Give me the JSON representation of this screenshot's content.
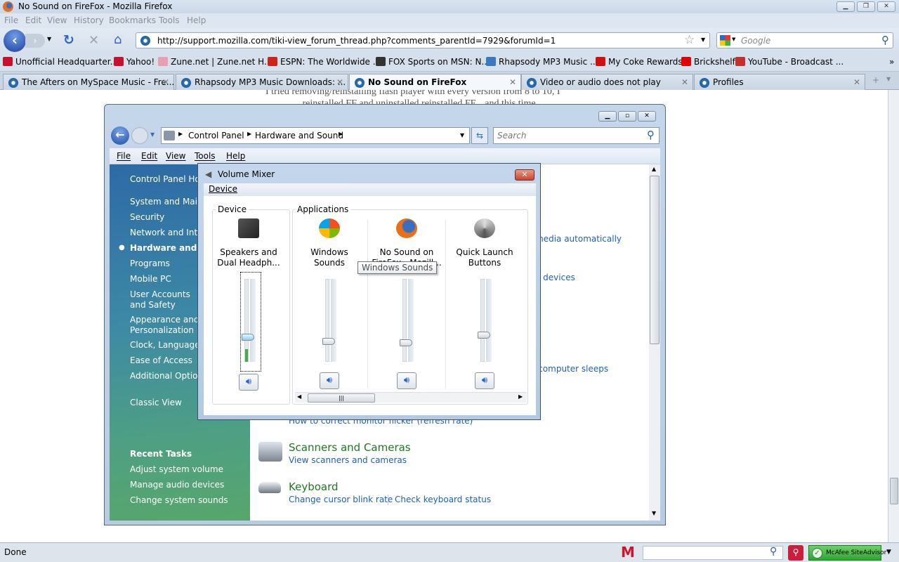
{
  "browser": {
    "title": "No Sound on FireFox - Mozilla Firefox",
    "menu": [
      "File",
      "Edit",
      "View",
      "History",
      "Bookmarks",
      "Tools",
      "Help"
    ],
    "url": "http://support.mozilla.com/tiki-view_forum_thread.php?comments_parentId=7929&forumId=1",
    "search_placeholder": "Google",
    "bookmarks": [
      {
        "label": "Unofficial Headquarter...",
        "icon": "yahoo-icon",
        "color": "#c8102e"
      },
      {
        "label": "Yahoo!",
        "icon": "yahoo-icon",
        "color": "#c8102e"
      },
      {
        "label": "Zune.net | Zune.net H...",
        "icon": "zune-icon",
        "color": "#e8a0b0"
      },
      {
        "label": "ESPN: The Worldwide ...",
        "icon": "espn-icon",
        "color": "#d0221a"
      },
      {
        "label": "FOX Sports on MSN: N...",
        "icon": "fox-icon",
        "color": "#333333"
      },
      {
        "label": "Rhapsody MP3 Music ...",
        "icon": "rhapsody-icon",
        "color": "#3a78c2"
      },
      {
        "label": "My Coke Rewards",
        "icon": "coke-icon",
        "color": "#d01010"
      },
      {
        "label": "Brickshelf",
        "icon": "brick-icon",
        "color": "#e00000"
      },
      {
        "label": "YouTube - Broadcast ...",
        "icon": "youtube-icon",
        "color": "#c4302b"
      }
    ],
    "tabs": [
      {
        "label": "The Afters on MySpace Music - Fre...",
        "active": false
      },
      {
        "label": "Rhapsody MP3 Music Downloads: ...",
        "active": false
      },
      {
        "label": "No Sound on FireFox",
        "active": true
      },
      {
        "label": "Video or audio does not play",
        "active": false
      },
      {
        "label": "Profiles",
        "active": false
      }
    ],
    "page_text": [
      "I tried removing/reinstalling flash player with every version from 8 to 10, I",
      "...reinstalled FF and uninstalled reinstalled FF... and this time..."
    ],
    "status": "Done",
    "mcafee": "McAfee SiteAdvisor"
  },
  "explorer": {
    "breadcrumb": [
      "Control Panel",
      "Hardware and Sound"
    ],
    "search_placeholder": "Search",
    "menu": [
      "File",
      "Edit",
      "View",
      "Tools",
      "Help"
    ],
    "sidebar": [
      {
        "label": "Control Panel Home"
      },
      {
        "label": "System and Maintenance"
      },
      {
        "label": "Security"
      },
      {
        "label": "Network and Internet"
      },
      {
        "label": "Hardware and Sound",
        "active": true
      },
      {
        "label": "Programs"
      },
      {
        "label": "Mobile PC"
      },
      {
        "label": "User Accounts and Safety"
      },
      {
        "label": "Appearance and Personalization"
      },
      {
        "label": "Clock, Language, and Region"
      },
      {
        "label": "Ease of Access"
      },
      {
        "label": "Additional Options"
      },
      {
        "label": "Classic View"
      }
    ],
    "recent_tasks_title": "Recent Tasks",
    "recent_tasks": [
      "Adjust system volume",
      "Manage audio devices",
      "Change system sounds"
    ],
    "partial_links": [
      "media automatically",
      "o devices",
      "e computer sleeps",
      "How to correct monitor flicker (refresh rate)"
    ],
    "categories": [
      {
        "title": "Scanners and Cameras",
        "links": [
          "View scanners and cameras"
        ]
      },
      {
        "title": "Keyboard",
        "links": [
          "Change cursor blink rate",
          "Check keyboard status"
        ]
      }
    ]
  },
  "mixer": {
    "title": "Volume Mixer",
    "menu": "Device",
    "device_group": "Device",
    "apps_group": "Applications",
    "tooltip": "Windows Sounds",
    "channels": [
      {
        "name": "Speakers and Dual Headph...",
        "line1": "Speakers and",
        "line2": "Dual Headph...",
        "icon": "laptop-speakers-icon",
        "volume": 0.3,
        "meter": 0.15
      },
      {
        "name": "Windows Sounds",
        "line1": "Windows",
        "line2": "Sounds",
        "icon": "windows-logo-icon",
        "volume": 0.25
      },
      {
        "name": "No Sound on FireFox - Mozill...",
        "line1": "No Sound on",
        "line2": "FireFox - Mozill...",
        "icon": "firefox-icon",
        "volume": 0.23
      },
      {
        "name": "Quick Launch Buttons",
        "line1": "Quick Launch",
        "line2": "Buttons",
        "icon": "quick-launch-icon",
        "volume": 0.32
      }
    ]
  }
}
